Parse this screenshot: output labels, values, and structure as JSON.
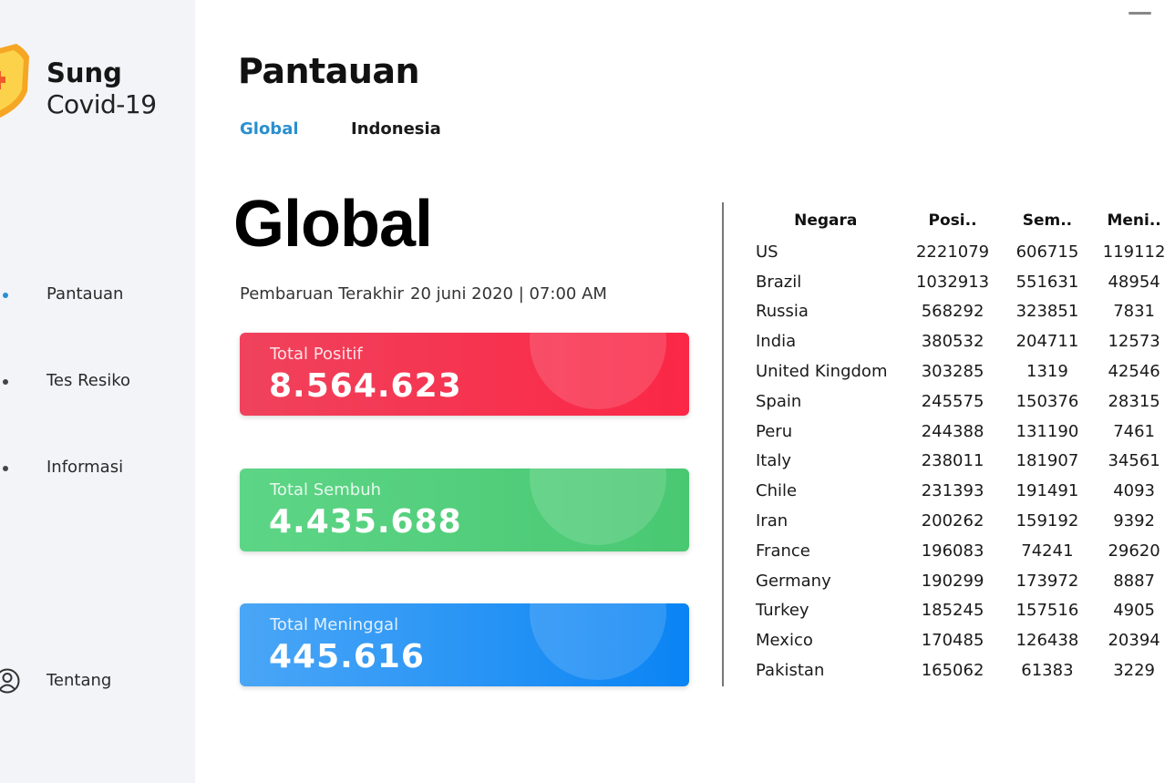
{
  "brand": {
    "name": "Sung",
    "subtitle": "Covid-19"
  },
  "nav": {
    "items": [
      {
        "label": "Pantauan",
        "active": true
      },
      {
        "label": "Tes Resiko",
        "active": false
      },
      {
        "label": "Informasi",
        "active": false
      }
    ],
    "about_label": "Tentang"
  },
  "page": {
    "title": "Pantauan",
    "tabs": [
      {
        "label": "Global",
        "active": true
      },
      {
        "label": "Indonesia",
        "active": false
      }
    ],
    "heading": "Global",
    "update_label": "Pembaruan Terakhir",
    "update_value": "20 juni 2020 | 07:00 AM"
  },
  "stats": {
    "positif": {
      "label": "Total Positif",
      "value": "8.564.623",
      "color": "#f5334f"
    },
    "sembuh": {
      "label": "Total Sembuh",
      "value": "4.435.688",
      "color": "#52cf7c"
    },
    "meninggal": {
      "label": "Total Meninggal",
      "value": "445.616",
      "color": "#1a8ff5"
    }
  },
  "table": {
    "headers": [
      "Negara",
      "Posi..",
      "Sem..",
      "Meni.."
    ],
    "rows": [
      [
        "US",
        "2221079",
        "606715",
        "119112"
      ],
      [
        "Brazil",
        "1032913",
        "551631",
        "48954"
      ],
      [
        "Russia",
        "568292",
        "323851",
        "7831"
      ],
      [
        "India",
        "380532",
        "204711",
        "12573"
      ],
      [
        "United Kingdom",
        "303285",
        "1319",
        "42546"
      ],
      [
        "Spain",
        "245575",
        "150376",
        "28315"
      ],
      [
        "Peru",
        "244388",
        "131190",
        "7461"
      ],
      [
        "Italy",
        "238011",
        "181907",
        "34561"
      ],
      [
        "Chile",
        "231393",
        "191491",
        "4093"
      ],
      [
        "Iran",
        "200262",
        "159192",
        "9392"
      ],
      [
        "France",
        "196083",
        "74241",
        "29620"
      ],
      [
        "Germany",
        "190299",
        "173972",
        "8887"
      ],
      [
        "Turkey",
        "185245",
        "157516",
        "4905"
      ],
      [
        "Mexico",
        "170485",
        "126438",
        "20394"
      ],
      [
        "Pakistan",
        "165062",
        "61383",
        "3229"
      ]
    ]
  },
  "icons": {
    "logo": "shield-plus-icon",
    "about": "user-icon",
    "window": "minimize-icon"
  },
  "colors": {
    "accent": "#2a8fcf",
    "sidebar_bg": "#f3f4f8",
    "shield_orange": "#f5a623"
  }
}
